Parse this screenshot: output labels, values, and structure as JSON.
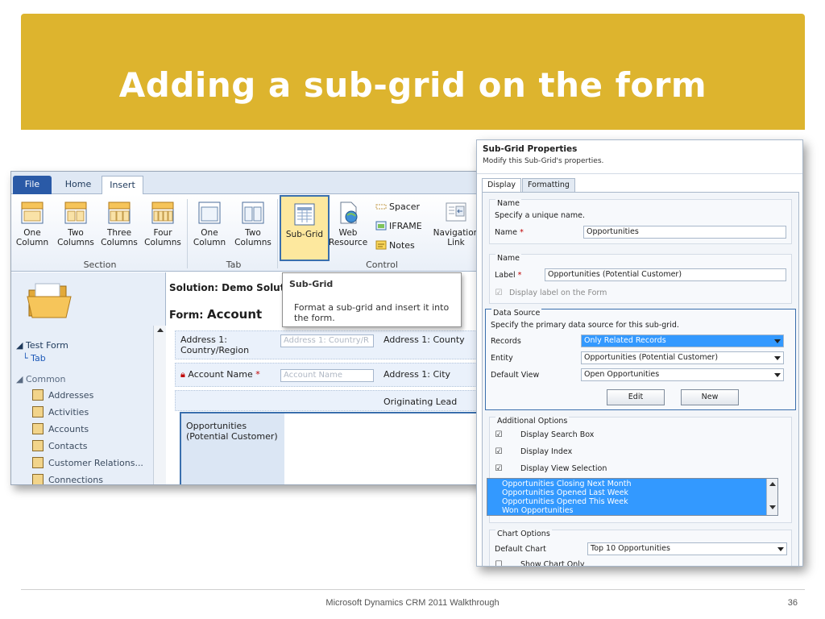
{
  "slide": {
    "title": "Adding a sub-grid on the form",
    "footer": "Microsoft Dynamics CRM 2011 Walkthrough",
    "page_number": "36",
    "colors": {
      "banner": "#DDB42E",
      "highlight_border": "#3a6fad",
      "selection": "#3399ff"
    }
  },
  "crm": {
    "tabs": {
      "file": "File",
      "home": "Home",
      "insert": "Insert"
    },
    "ribbon": {
      "section_buttons": [
        {
          "line1": "One",
          "line2": "Column"
        },
        {
          "line1": "Two",
          "line2": "Columns"
        },
        {
          "line1": "Three",
          "line2": "Columns"
        },
        {
          "line1": "Four",
          "line2": "Columns"
        }
      ],
      "tab_buttons": [
        {
          "line1": "One",
          "line2": "Column"
        },
        {
          "line1": "Two",
          "line2": "Columns"
        }
      ],
      "subgrid": "Sub-Grid",
      "web_resource": {
        "line1": "Web",
        "line2": "Resource"
      },
      "spacer": "Spacer",
      "iframe": "IFRAME",
      "notes": "Notes",
      "navigation_link": {
        "line1": "Navigation",
        "line2": "Link"
      },
      "groups": {
        "section": "Section",
        "tab": "Tab",
        "control": "Control"
      }
    },
    "nav": {
      "test_form": "Test Form",
      "tab": "Tab",
      "common": "Common",
      "items": [
        "Addresses",
        "Activities",
        "Accounts",
        "Contacts",
        "Customer Relations...",
        "Connections"
      ]
    },
    "form": {
      "solution": "Solution: Demo Solut",
      "form_label": "Form:",
      "form_name": "Account",
      "rows": [
        {
          "label": "Address 1: Country/Region",
          "placeholder": "Address 1: Country/R",
          "right": "Address 1: County"
        },
        {
          "label": "Account Name",
          "placeholder": "Account Name",
          "right": "Address 1: City"
        },
        {
          "label": "",
          "placeholder": "",
          "right": "Originating Lead"
        }
      ],
      "subgrid_label": "Opportunities (Potential Customer)"
    },
    "tooltip": {
      "title": "Sub-Grid",
      "body": "Format a sub-grid and insert it into the form."
    }
  },
  "dialog": {
    "title": "Sub-Grid Properties",
    "subtitle": "Modify this Sub-Grid's properties.",
    "tabs": {
      "display": "Display",
      "formatting": "Formatting"
    },
    "name_section": {
      "title": "Name",
      "hint": "Specify a unique name.",
      "name_label": "Name",
      "name_value": "Opportunities"
    },
    "label_section": {
      "title": "Name",
      "label_label": "Label",
      "label_value": "Opportunities (Potential Customer)",
      "display_label": "Display label on the Form"
    },
    "data_source": {
      "title": "Data Source",
      "hint": "Specify the primary data source for this sub-grid.",
      "records_label": "Records",
      "records_value": "Only Related Records",
      "entity_label": "Entity",
      "entity_value": "Opportunities (Potential Customer)",
      "view_label": "Default View",
      "view_value": "Open Opportunities",
      "edit_button": "Edit",
      "new_button": "New"
    },
    "additional": {
      "title": "Additional Options",
      "search_box": "Display Search Box",
      "index": "Display Index",
      "view_selection": "Display View Selection",
      "views": [
        "Opportunities Closing Next Month",
        "Opportunities Opened Last Week",
        "Opportunities Opened This Week",
        "Won Opportunities"
      ]
    },
    "chart": {
      "title": "Chart Options",
      "default_chart_label": "Default Chart",
      "default_chart_value": "Top 10 Opportunities",
      "show_chart_only": "Show Chart Only"
    }
  }
}
